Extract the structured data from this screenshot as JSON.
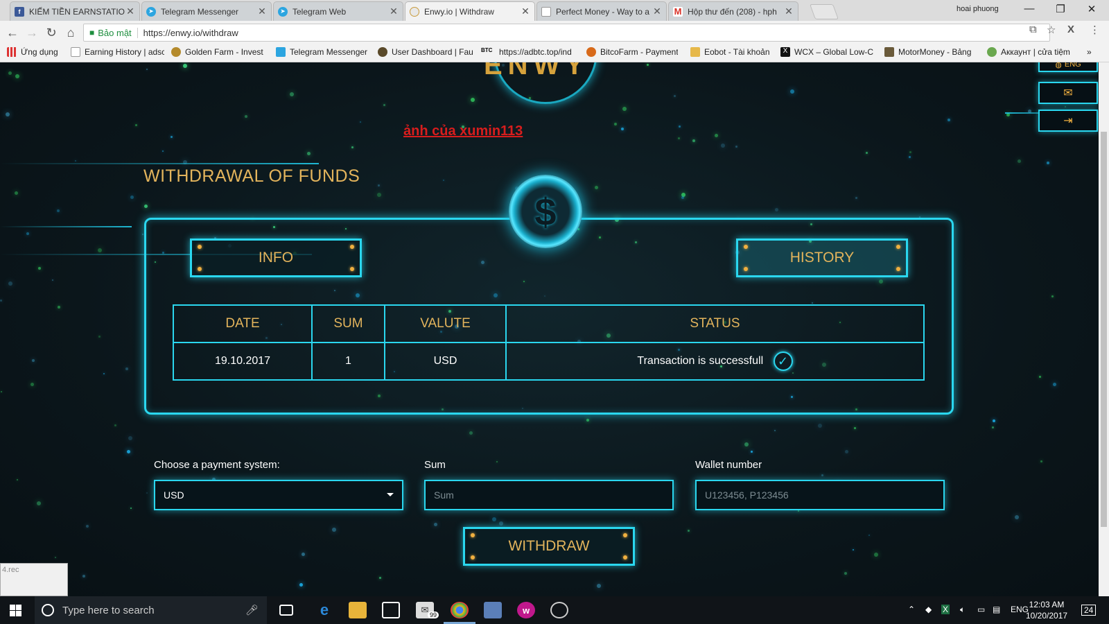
{
  "browser": {
    "tabs": [
      {
        "title": "KIẾM TIỀN EARNSTATION",
        "favicon": "facebook-icon",
        "color": "#3b5998"
      },
      {
        "title": "Telegram Messenger",
        "favicon": "telegram-icon",
        "color": "#2ca5e0"
      },
      {
        "title": "Telegram Web",
        "favicon": "telegram-icon",
        "color": "#2ca5e0"
      },
      {
        "title": "Enwy.io | Withdraw",
        "favicon": "enwy-icon",
        "color": "#e3b45c",
        "active": true
      },
      {
        "title": "Perfect Money - Way to a",
        "favicon": "page-icon",
        "color": "#999999"
      },
      {
        "title": "Hộp thư đến (208) - hph",
        "favicon": "gmail-icon",
        "color": "#d93025"
      }
    ],
    "profile_name": "hoai phuong",
    "secure_label": "Bảo mật",
    "url": "https://enwy.io/withdraw",
    "bookmarks": [
      {
        "label": "Ứng dụng",
        "icon": "apps-icon"
      },
      {
        "label": "Earning History | adsc",
        "icon": "page-icon"
      },
      {
        "label": "Golden Farm - Invest",
        "icon": "farm-icon"
      },
      {
        "label": "Telegram Messenger",
        "icon": "telegram-icon"
      },
      {
        "label": "User Dashboard | Fau",
        "icon": "dashboard-icon"
      },
      {
        "label": "https://adbtc.top/ind",
        "icon": "btc-icon"
      },
      {
        "label": "BitcoFarm - Payment",
        "icon": "farm-icon"
      },
      {
        "label": "Eobot - Tài khoản",
        "icon": "eobot-icon"
      },
      {
        "label": "WCX – Global Low-C",
        "icon": "wcx-icon"
      },
      {
        "label": "MotorMoney - Bảng",
        "icon": "car-icon"
      },
      {
        "label": "Аккаунт | cửa tiệm",
        "icon": "frog-icon"
      }
    ],
    "btc_fav": "BTC",
    "more": "»"
  },
  "page": {
    "watermark": "ảnh của xumin113",
    "title": "WITHDRAWAL OF FUNDS",
    "lang_label": "ENG",
    "info_button": "INFO",
    "history_button": "HISTORY",
    "table": {
      "headers": [
        "DATE",
        "SUM",
        "VALUTE",
        "STATUS"
      ],
      "rows": [
        {
          "date": "19.10.2017",
          "sum": "1",
          "valute": "USD",
          "status": "Transaction is successfull"
        }
      ]
    },
    "form": {
      "payment_label": "Choose a payment system:",
      "payment_value": "USD",
      "sum_label": "Sum",
      "sum_placeholder": "Sum",
      "wallet_label": "Wallet number",
      "wallet_placeholder": "U123456, P123456",
      "submit": "WITHDRAW"
    },
    "accent_color": "#2ad7ef",
    "gold_color": "#e3b45c"
  },
  "rec_panel": {
    "label": "4.rec"
  },
  "taskbar": {
    "search_placeholder": "Type here to search",
    "mail_badge": "99",
    "lang": "ENG",
    "time": "12:03 AM",
    "date": "10/20/2017",
    "notification_count": "24"
  }
}
